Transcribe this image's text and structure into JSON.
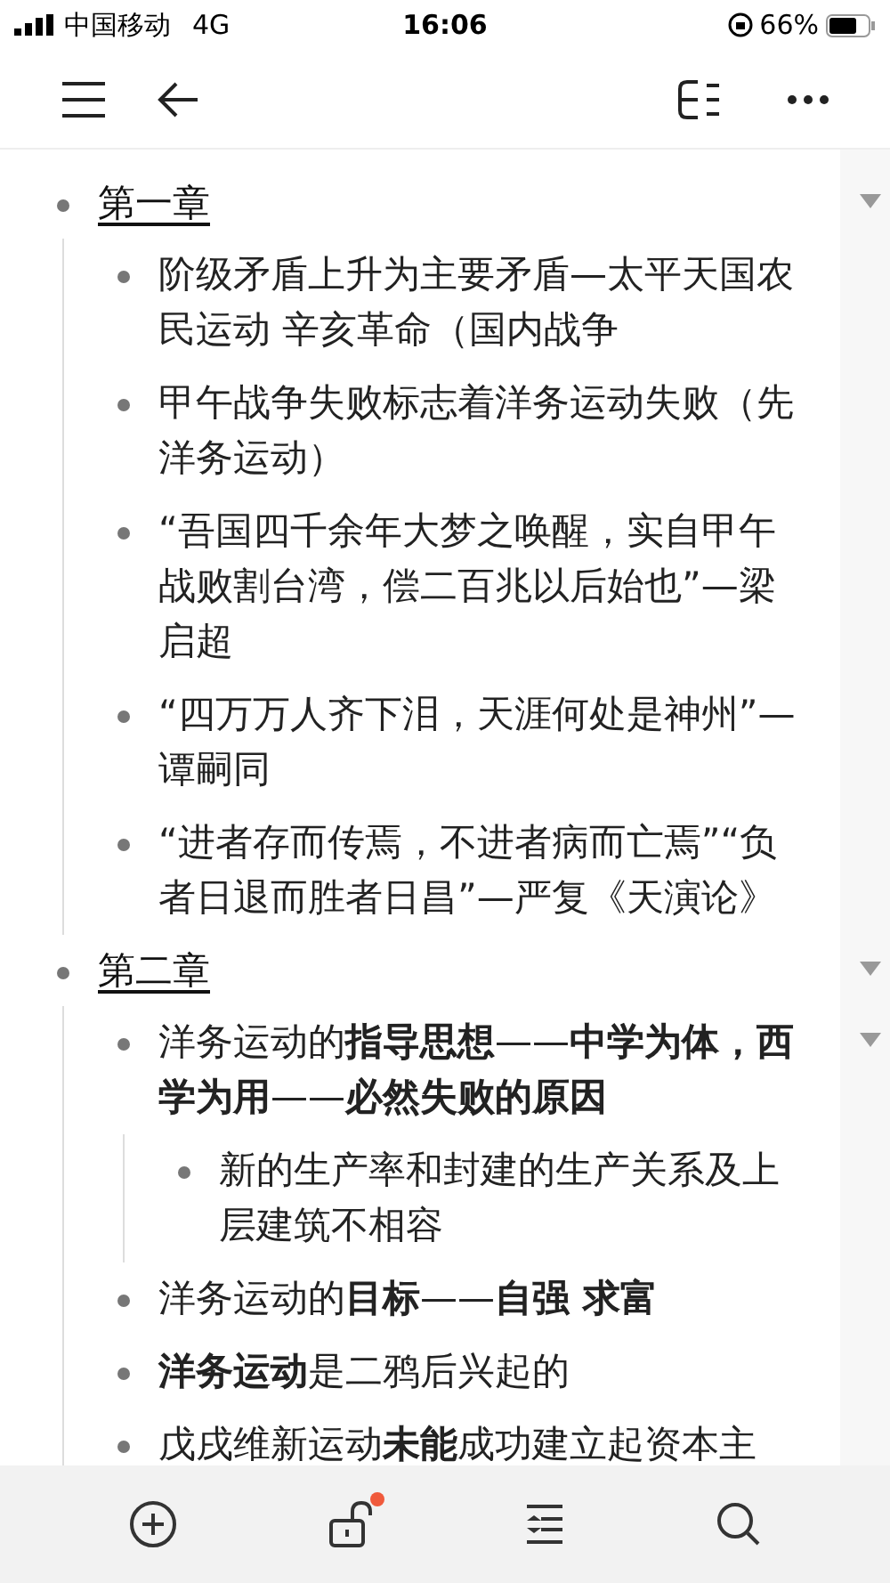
{
  "status_bar": {
    "carrier": "中国移动",
    "network": "4G",
    "time": "16:06",
    "battery": "66%"
  },
  "outline": [
    {
      "text": "第一章",
      "expanded": true,
      "children": [
        {
          "text": "阶级矛盾上升为主要矛盾—太平天国农民运动 辛亥革命（国内战争"
        },
        {
          "text": "甲午战争失败标志着洋务运动失败（先洋务运动）"
        },
        {
          "text": "“吾国四千余年大梦之唤醒，实自甲午战败割台湾，偿二百兆以后始也”—梁启超"
        },
        {
          "text": "“四万万人齐下泪，天涯何处是神州”—谭嗣同"
        },
        {
          "text": "“进者存而传焉，不进者病而亡焉”“负者日退而胜者日昌”—严复《天演论》"
        }
      ]
    },
    {
      "text": "第二章",
      "expanded": true,
      "children": [
        {
          "text": "洋务运动的**指导思想**——**中学为体，西学为用**——**必然失败的原因**",
          "expanded": true,
          "children": [
            {
              "text": "新的生产率和封建的生产关系及上层建筑不相容"
            }
          ]
        },
        {
          "text": "洋务运动的**目标**——**自强 求富**"
        },
        {
          "text": "**洋务运动**是二鸦后兴起的"
        },
        {
          "text": "戊戌维新运动**未能**成功建立起资本主"
        }
      ]
    }
  ],
  "bottom_bar": {
    "unlock_badge": true
  }
}
